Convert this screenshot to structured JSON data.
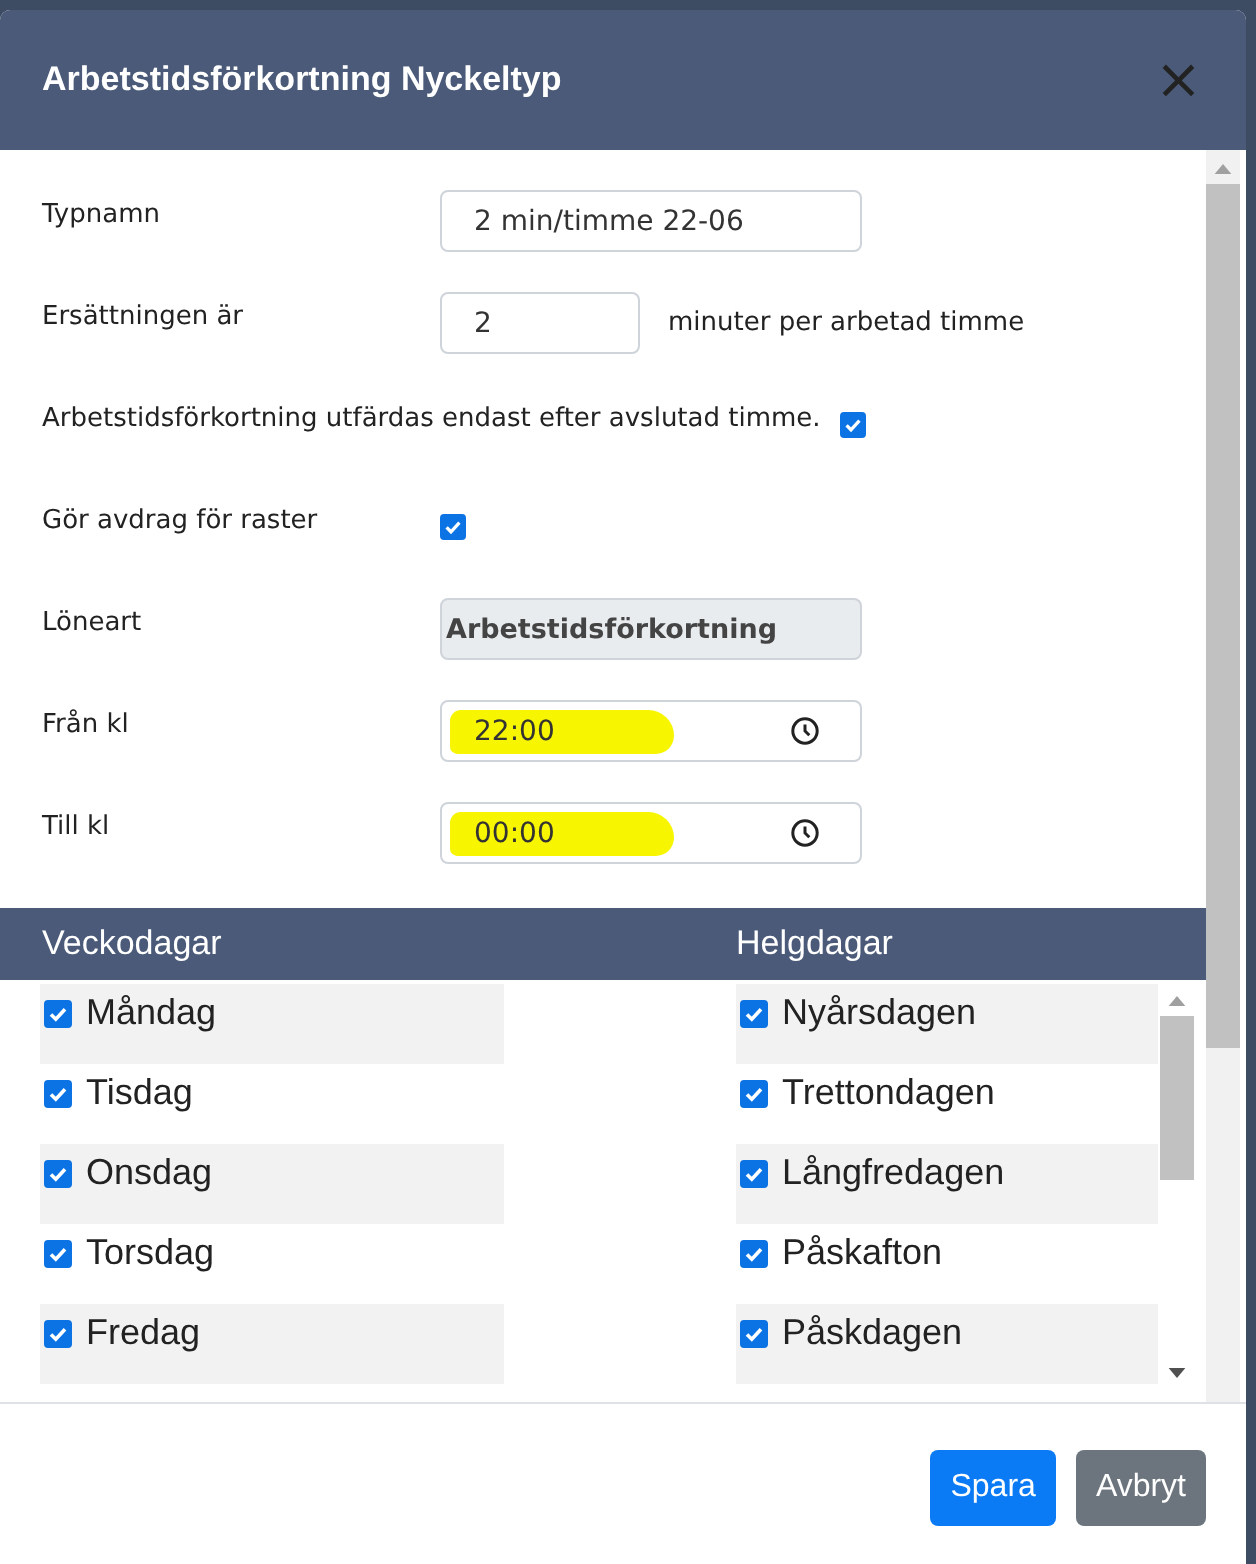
{
  "dialog": {
    "title": "Arbetstidsförkortning Nyckeltyp",
    "close": "×"
  },
  "fields": [
    {
      "kind": "text",
      "label": "Typnamn",
      "value": "2 min/timme 22-06"
    },
    {
      "kind": "number",
      "label": "Ersättningen är",
      "value": "2",
      "suffix": "minuter per arbetad timme"
    },
    {
      "kind": "checkbox",
      "label": "Arbetstidsförkortning utfärdas endast efter avslutad timme.",
      "checked": true
    },
    {
      "kind": "checkbox",
      "label": "Gör avdrag för raster",
      "checked": true
    },
    {
      "kind": "readonly",
      "label": "Löneart",
      "value": "Arbetstidsförkortning"
    },
    {
      "kind": "time",
      "label": "Från kl",
      "value": "22:00",
      "highlighted": true
    },
    {
      "kind": "time",
      "label": "Till kl",
      "value": "00:00",
      "highlighted": true
    }
  ],
  "days_table": {
    "columns": [
      "Veckodagar",
      "Helgdagar"
    ],
    "weekdays": [
      {
        "label": "Måndag",
        "checked": true
      },
      {
        "label": "Tisdag",
        "checked": true
      },
      {
        "label": "Onsdag",
        "checked": true
      },
      {
        "label": "Torsdag",
        "checked": true
      },
      {
        "label": "Fredag",
        "checked": true
      }
    ],
    "holidays": [
      {
        "label": "Nyårsdagen",
        "checked": true
      },
      {
        "label": "Trettondagen",
        "checked": true
      },
      {
        "label": "Långfredagen",
        "checked": true
      },
      {
        "label": "Påskafton",
        "checked": true
      },
      {
        "label": "Påskdagen",
        "checked": true
      }
    ]
  },
  "buttons": [
    {
      "label": "Spara",
      "kind": "primary"
    },
    {
      "label": "Avbryt",
      "kind": "secondary"
    }
  ]
}
